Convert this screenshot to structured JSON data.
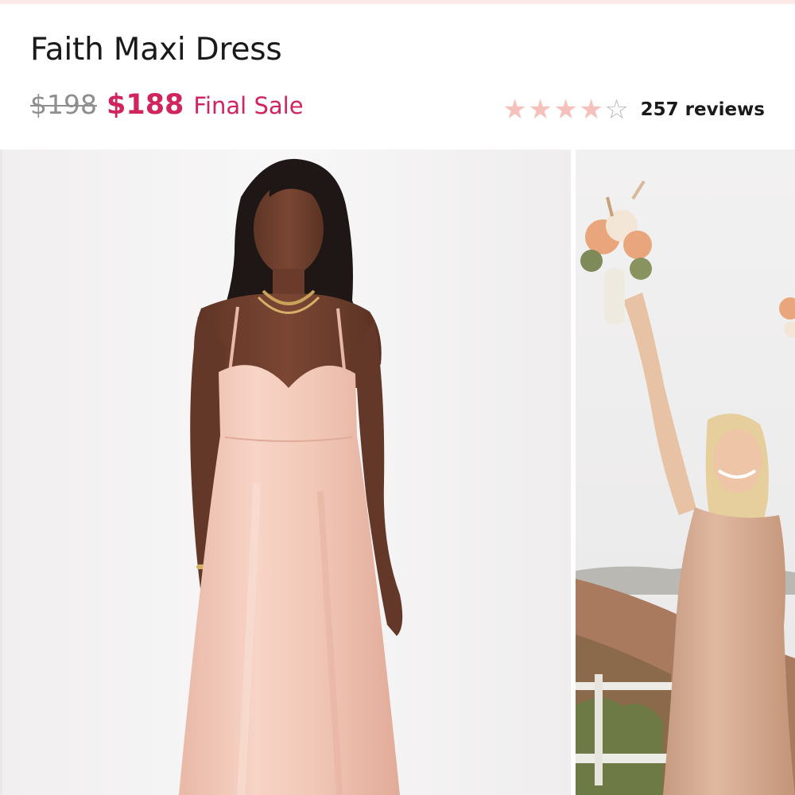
{
  "product": {
    "title": "Faith Maxi Dress",
    "original_price": "$198",
    "sale_price": "$188",
    "sale_label": "Final Sale"
  },
  "rating": {
    "stars": 4,
    "max_stars": 5,
    "reviews_label": "257 reviews",
    "filled_star_color": "#f5c1bb",
    "empty_star_color": "#b7b7b7"
  },
  "colors": {
    "accent": "#d0255c",
    "title": "#1a1a1a",
    "strike_price": "#8e8e8e"
  },
  "gallery": {
    "images": [
      {
        "name": "model-front-pink-satin-dress"
      },
      {
        "name": "bridesmaid-holding-bouquet-outdoors"
      }
    ]
  }
}
